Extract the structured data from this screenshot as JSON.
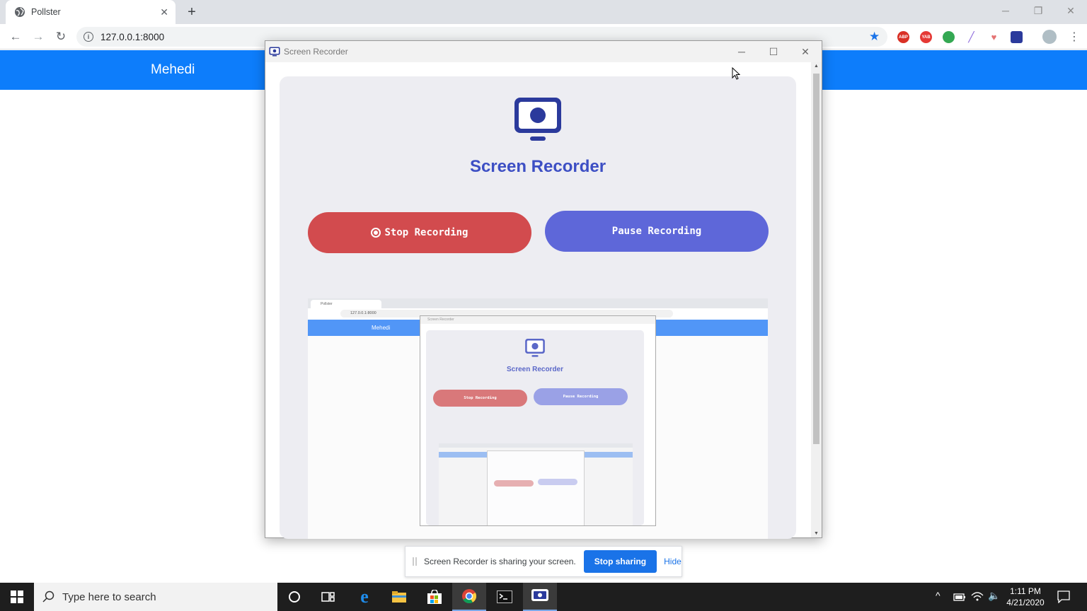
{
  "browser": {
    "tab_title": "Pollster",
    "url": "127.0.0.1:8000"
  },
  "page": {
    "brand": "Mehedi"
  },
  "popup": {
    "window_title": "Screen Recorder",
    "heading": "Screen Recorder",
    "stop_label": "Stop Recording",
    "pause_label": "Pause Recording"
  },
  "preview": {
    "tab_title": "Pollster",
    "url": "127.0.0.1:8000",
    "brand": "Mehedi",
    "window_title": "Screen Recorder",
    "heading": "Screen Recorder",
    "stop_label": "Stop Recording",
    "pause_label": "Pause Recording"
  },
  "sharebar": {
    "message": "Screen Recorder is sharing your screen.",
    "stop_label": "Stop sharing",
    "hide_label": "Hide"
  },
  "taskbar": {
    "search_placeholder": "Type here to search",
    "time": "1:11 PM",
    "date": "4/21/2020"
  },
  "colors": {
    "header_blue": "#0d7dfb",
    "stop_red": "#d24b4e",
    "pause_blue": "#5e67d9",
    "heading_blue": "#3d4fc4",
    "share_blue": "#1a73e8"
  }
}
